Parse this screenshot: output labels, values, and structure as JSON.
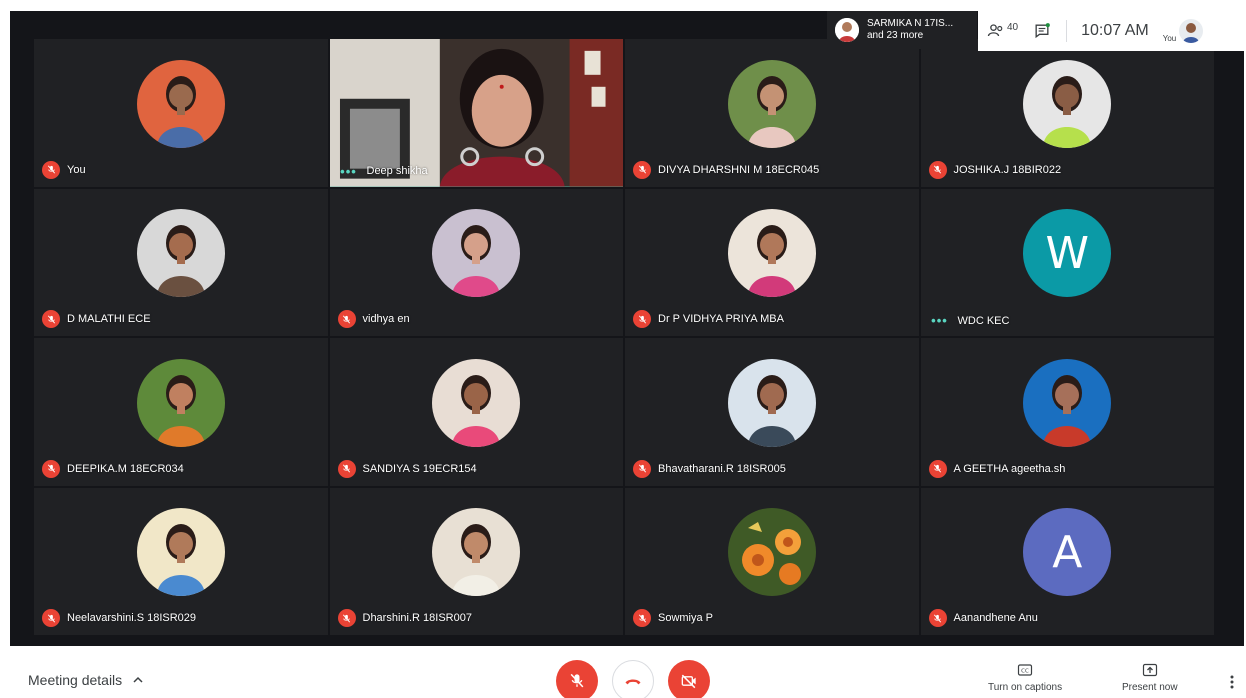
{
  "presenter_chip": {
    "line1": "SARMIKA N 17IS...",
    "line2": "and 23 more"
  },
  "top_bar": {
    "participant_count": "40",
    "time": "10:07 AM",
    "self_label": "You"
  },
  "participants": [
    {
      "name": "You",
      "muted": true,
      "kind": "photo",
      "bg": "#e0643f",
      "skin": "#9a6a4e",
      "shirt": "#4a6da8"
    },
    {
      "name": "Deep shikha",
      "muted": false,
      "kind": "video",
      "speaking": true
    },
    {
      "name": "DIVYA DHARSHNI M 18ECR045",
      "muted": true,
      "kind": "photo",
      "bg": "#6f8f4a",
      "skin": "#c49274",
      "shirt": "#e8c8c0"
    },
    {
      "name": "JOSHIKA.J 18BIR022",
      "muted": true,
      "kind": "photo",
      "bg": "#e6e6e6",
      "skin": "#8a5d45",
      "shirt": "#b6e04c"
    },
    {
      "name": "D MALATHI ECE",
      "muted": true,
      "kind": "photo",
      "bg": "#d8d8d8",
      "skin": "#a56c4e",
      "shirt": "#6a5040"
    },
    {
      "name": "vidhya en",
      "muted": true,
      "kind": "photo",
      "bg": "#c9c0d0",
      "skin": "#d5a08a",
      "shirt": "#e04a8a"
    },
    {
      "name": "Dr P VIDHYA PRIYA MBA",
      "muted": true,
      "kind": "photo",
      "bg": "#ece4da",
      "skin": "#b0785a",
      "shirt": "#d23a7a"
    },
    {
      "name": "WDC KEC",
      "muted": false,
      "kind": "letter",
      "letter": "W",
      "bg": "#0b9aa6"
    },
    {
      "name": "DEEPIKA.M 18ECR034",
      "muted": true,
      "kind": "photo",
      "bg": "#5e8a3a",
      "skin": "#c08060",
      "shirt": "#e07a2a"
    },
    {
      "name": "SANDIYA S 19ECR154",
      "muted": true,
      "kind": "photo",
      "bg": "#e8ddd4",
      "skin": "#9a6448",
      "shirt": "#e94a7a"
    },
    {
      "name": "Bhavatharani.R 18ISR005",
      "muted": true,
      "kind": "photo",
      "bg": "#d9e3ec",
      "skin": "#a06a50",
      "shirt": "#3a4a5a"
    },
    {
      "name": "A GEETHA ageetha.sh",
      "muted": true,
      "kind": "photo",
      "bg": "#1a6fc0",
      "skin": "#a6705a",
      "shirt": "#c83a2a"
    },
    {
      "name": "Neelavarshini.S 18ISR029",
      "muted": true,
      "kind": "photo",
      "bg": "#f1e7c8",
      "skin": "#b07a5a",
      "shirt": "#4a8ad0"
    },
    {
      "name": "Dharshini.R 18ISR007",
      "muted": true,
      "kind": "photo",
      "bg": "#e8e0d4",
      "skin": "#c08a6a",
      "shirt": "#f2efe6"
    },
    {
      "name": "Sowmiya P",
      "muted": true,
      "kind": "flower",
      "bg": "#3f5a26"
    },
    {
      "name": "Aanandhene Anu",
      "muted": true,
      "kind": "letter",
      "letter": "A",
      "bg": "#5c6bc0"
    }
  ],
  "bottom_bar": {
    "meeting_details": "Meeting details",
    "captions": "Turn on captions",
    "present": "Present now"
  },
  "colors": {
    "muted_red": "#ea4335",
    "speaking_teal": "#5ad6c1",
    "tile_bg": "#202124"
  },
  "icons": [
    "mic-off-icon",
    "hang-up-icon",
    "camera-off-icon",
    "people-icon",
    "chat-icon",
    "captions-icon",
    "present-icon",
    "more-vert-icon",
    "chevron-up-icon"
  ]
}
